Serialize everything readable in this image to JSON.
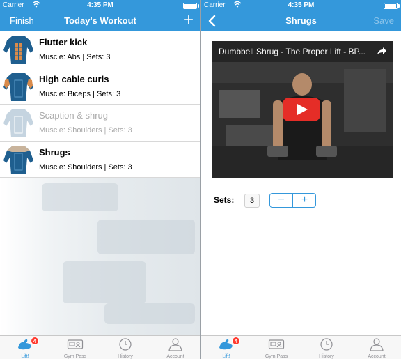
{
  "colors": {
    "accent": "#3498db",
    "badge": "#ff3b30",
    "muscle_highlight": "#d98b4b"
  },
  "status_bar": {
    "carrier": "Carrier",
    "time": "4:35 PM"
  },
  "left": {
    "nav": {
      "finish_label": "Finish",
      "title": "Today's Workout",
      "add_icon": "plus-icon"
    },
    "exercises": [
      {
        "name": "Flutter kick",
        "meta": "Muscle: Abs | Sets: 3",
        "highlight": "abs"
      },
      {
        "name": "High cable curls",
        "meta": "Muscle: Biceps | Sets: 3",
        "highlight": "arms"
      },
      {
        "name": "Scaption & shrug",
        "meta": "Muscle: Shoulders | Sets: 3",
        "highlight": "none"
      },
      {
        "name": "Shrugs",
        "meta": "Muscle: Shoulders | Sets: 3",
        "highlight": "shoulders"
      }
    ]
  },
  "right": {
    "nav": {
      "back_icon": "chevron-left-icon",
      "title": "Shrugs",
      "save_label": "Save"
    },
    "video": {
      "title": "Dumbbell Shrug - The Proper Lift - BP...",
      "share_icon": "share-icon",
      "play_icon": "play-icon"
    },
    "sets": {
      "label": "Sets:",
      "value": "3",
      "minus": "−",
      "plus": "+"
    }
  },
  "tabbar": {
    "badge": "4",
    "tabs": [
      {
        "label": "Lift!",
        "icon": "bicep-icon"
      },
      {
        "label": "Gym Pass",
        "icon": "id-card-icon"
      },
      {
        "label": "History",
        "icon": "clock-icon"
      },
      {
        "label": "Account",
        "icon": "person-icon"
      }
    ]
  }
}
